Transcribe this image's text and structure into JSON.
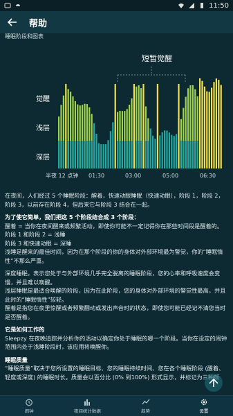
{
  "status": {
    "time": "11:50"
  },
  "appbar": {
    "title": "帮助"
  },
  "section_header": "睡眠阶段和图表",
  "chart": {
    "awake_label": "短暂觉醒",
    "y_labels": [
      "觉醒",
      "浅层",
      "深层"
    ],
    "x_labels": [
      "半夜 12 点钟",
      "01:30",
      "03:00",
      "05:00",
      "06:30"
    ]
  },
  "chart_data": {
    "type": "bar",
    "title": "",
    "ylabel": "",
    "xlabel": "",
    "levels": [
      "深层",
      "浅层",
      "觉醒"
    ],
    "x": [
      "半夜 12 点钟",
      "01:30",
      "03:00",
      "05:00",
      "06:30"
    ],
    "annotation": "短暂觉醒"
  },
  "text": {
    "p1": "在夜间，人们经过 5 个睡眠阶段：醒着，快速动眼睡眠（快速动眼），阶段 1，阶段 2，阶段 3，以前存在阶段 4，但后来它与阶段 3 结合在一起。",
    "p2_head": "为了使它简单，我们把这 5 个阶段结合成 3 个阶段：",
    "p2_l1": "醒着 = 当你在夜间醒来或频繁活动，即使你可能不一定记得你在那些时间段是醒着的。",
    "p2_l2": "阶段 1 和阶段 2 = 浅睡",
    "p2_l3": "阶段 3 和快速动眼 = 深睡",
    "p2_l4": "浅睡是醒来的最佳时间，因为在那个阶段的你的身体对外部环境最为警觉，你的“睡眠惰性”不那么严重。",
    "p3_l1": "深度睡眠，表示您处于与外部环境几乎完全脱离的睡眠阶段，您的心率和呼吸速度会变慢，并且难以唤醒。",
    "p3_l2": "浅层睡眠是最适合唤醒的阶段，因为在此阶段，您的身体对外部环境的警觉性最高，并且此时的“睡眠惰性”较轻。",
    "p3_l3": "醒着是指您在夜里惊醒或者频繁翻动或发出声音时的状态，即使您可能已经记不清您当时是否醒着。",
    "p4_head": "它是如何工作的",
    "p4_body": "Sleepzy 在夜晚追踪并分析你的活动以确定你处于睡眠的哪一个阶段。当你在设定的闹钟范围内处于浅睡阶段时，该应用将唤醒你。",
    "p5_head": "睡眠质量",
    "p5_body": "“睡眠质量”取决于您所设置的睡眠目标、您的睡眠持续时间、您在各个睡眠阶段 (醒着、轻度或深度) 的睡眠时长。质量会以百分比 (0% 到100%) 形式显示，并标记为三种颜"
  },
  "nav": {
    "items": [
      {
        "label": "闹钟"
      },
      {
        "label": "夜间统计数据"
      },
      {
        "label": "趋势"
      },
      {
        "label": "设置"
      }
    ]
  },
  "colors": {
    "yellow": "#f2e14b",
    "green": "#9fd44a",
    "teal": "#22a8a0",
    "bg": "#0d2a33"
  }
}
